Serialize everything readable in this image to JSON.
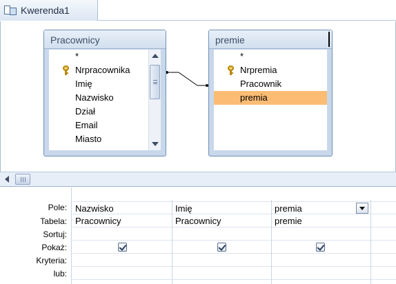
{
  "window": {
    "title": "Kwerenda1"
  },
  "tables": [
    {
      "name": "Pracownicy",
      "fields": [
        "*",
        "Nrpracownika",
        "Imię",
        "Nazwisko",
        "Dział",
        "Email",
        "Miasto"
      ],
      "key_field": "Nrpracownika"
    },
    {
      "name": "premie",
      "fields": [
        "*",
        "Nrpremia",
        "Pracownik",
        "premia"
      ],
      "key_field": "Nrpremia",
      "selected_field": "premia"
    }
  ],
  "grid": {
    "row_labels": [
      "Pole:",
      "Tabela:",
      "Sortuj:",
      "Pokaż:",
      "Kryteria:",
      "lub:"
    ],
    "columns": [
      {
        "field": "Nazwisko",
        "table": "Pracownicy",
        "sort": "",
        "show": true,
        "criteria": "",
        "or": ""
      },
      {
        "field": "Imię",
        "table": "Pracownicy",
        "sort": "",
        "show": true,
        "criteria": "",
        "or": ""
      },
      {
        "field": "premia",
        "table": "premie",
        "sort": "",
        "show": true,
        "criteria": "",
        "or": ""
      }
    ]
  },
  "colors": {
    "selected_field": "#fbbc74",
    "table_border": "#6f8fb6",
    "header_bg": "#d2dfee"
  }
}
